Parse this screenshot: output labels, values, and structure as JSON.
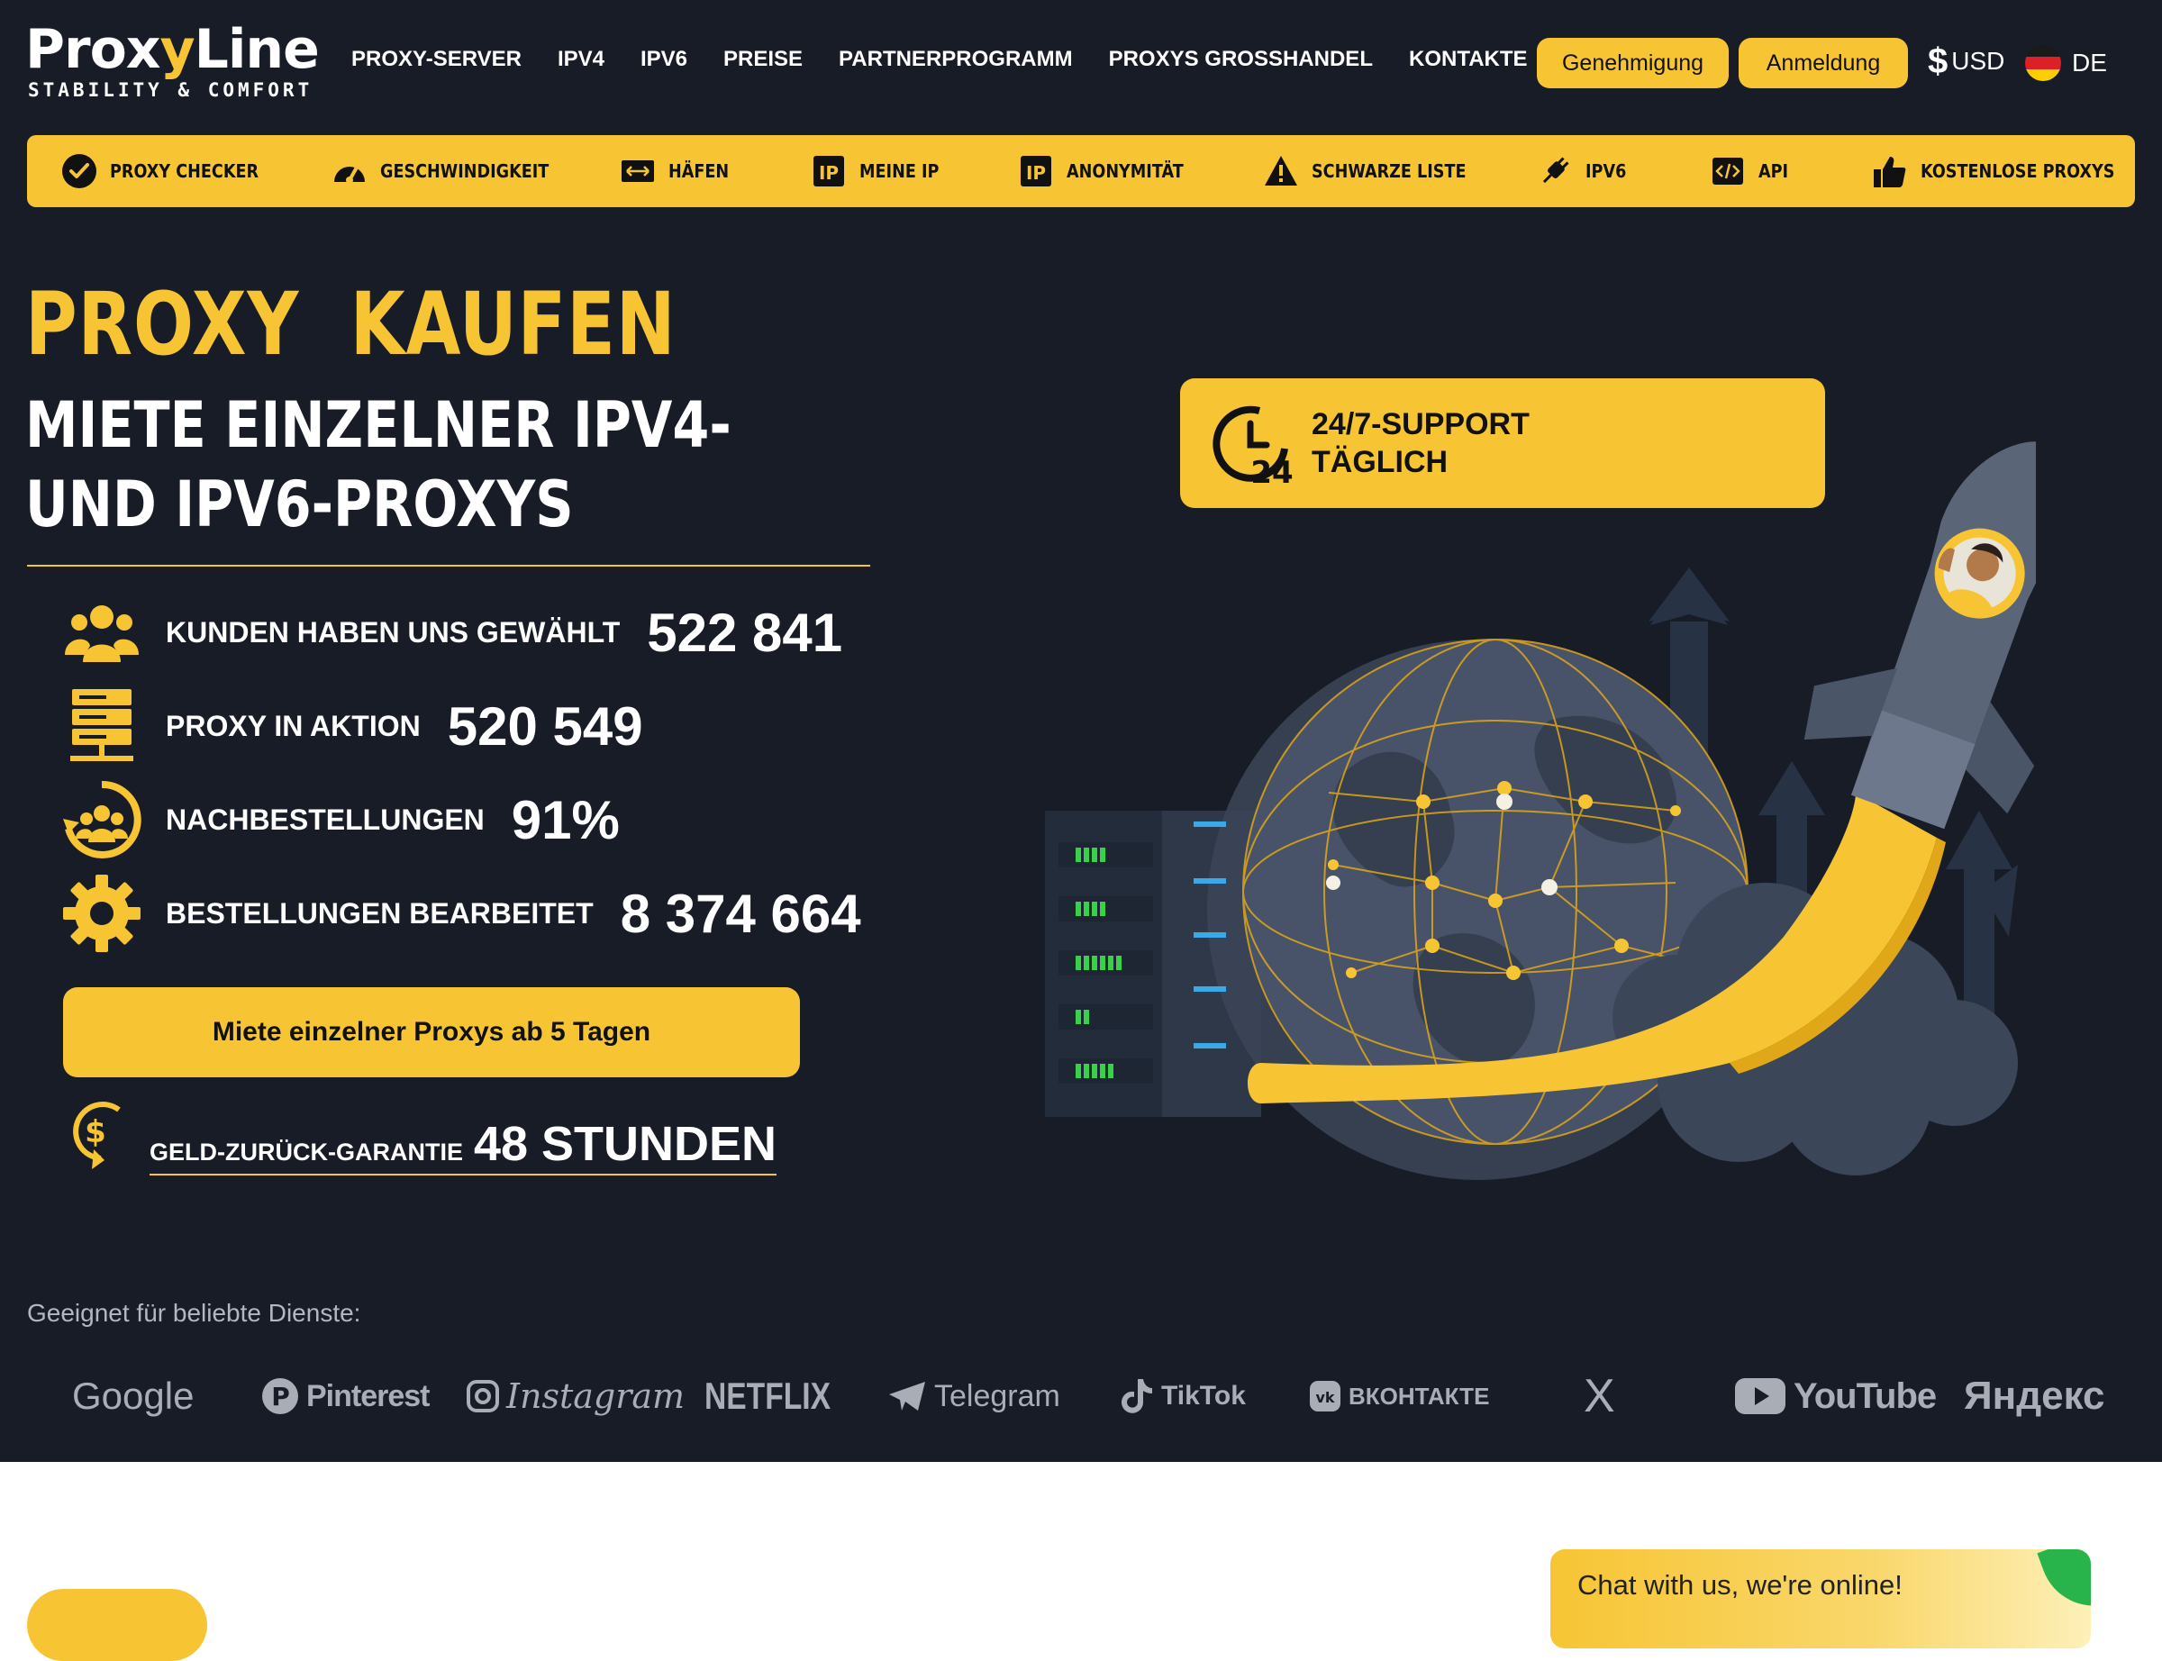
{
  "brand": {
    "name_a": "Prox",
    "name_y": "y",
    "name_b": "Line",
    "tagline": "STABILITY & COMFORT"
  },
  "nav": [
    "PROXY-SERVER",
    "IPV4",
    "IPV6",
    "PREISE",
    "PARTNERPROGRAMM",
    "PROXYS GROSSHANDEL",
    "KONTAKTE"
  ],
  "header": {
    "login_label": "Genehmigung",
    "register_label": "Anmeldung",
    "currency": "USD",
    "currency_symbol": "$",
    "language": "DE"
  },
  "tools": [
    {
      "label": "PROXY CHECKER",
      "icon": "check-circle-icon"
    },
    {
      "label": "GESCHWINDIGKEIT",
      "icon": "speedometer-icon"
    },
    {
      "label": "HÄFEN",
      "icon": "ports-arrows-icon"
    },
    {
      "label": "MEINE IP",
      "icon": "ip-icon"
    },
    {
      "label": "ANONYMITÄT",
      "icon": "ip-icon"
    },
    {
      "label": "SCHWARZE LISTE",
      "icon": "warning-icon"
    },
    {
      "label": "IPV6",
      "icon": "plug-icon"
    },
    {
      "label": "API",
      "icon": "code-icon"
    },
    {
      "label": "KOSTENLOSE PROXYS",
      "icon": "thumbs-up-icon"
    }
  ],
  "hero": {
    "title": "PROXY  KAUFEN",
    "subtitle": "MIETE EINZELNER IPV4- UND IPV6-PROXYS",
    "stats": [
      {
        "label": "KUNDEN HABEN UNS GEWÄHLT",
        "value": "522 841",
        "icon": "users-icon"
      },
      {
        "label": "PROXY IN AKTION",
        "value": "520 549",
        "icon": "server-icon"
      },
      {
        "label": "NACHBESTELLUNGEN",
        "value": "91%",
        "icon": "reorder-group-icon"
      },
      {
        "label": "BESTELLUNGEN BEARBEITET",
        "value": "8 374 664",
        "icon": "gear-icon"
      }
    ],
    "cta_label": "Miete einzelner Proxys ab 5 Tagen",
    "guarantee_label": "GELD-ZURÜCK-GARANTIE",
    "guarantee_value": "48 STUNDEN",
    "support_line1": "24/7-SUPPORT",
    "support_line2": "TÄGLICH",
    "support_icon_text": "24"
  },
  "services": {
    "label": "Geeignet für beliebte Dienste:",
    "items": [
      "Google",
      "Pinterest",
      "Instagram",
      "NETFLIX",
      "Telegram",
      "TikTok",
      "ВКОНТАКТЕ",
      "X",
      "YouTube",
      "Яндекс"
    ]
  },
  "chat": {
    "label": "Chat with us, we're online!"
  },
  "colors": {
    "accent": "#f7c534",
    "background": "#181c27",
    "text": "#ffffff",
    "muted": "#a9adb6"
  }
}
